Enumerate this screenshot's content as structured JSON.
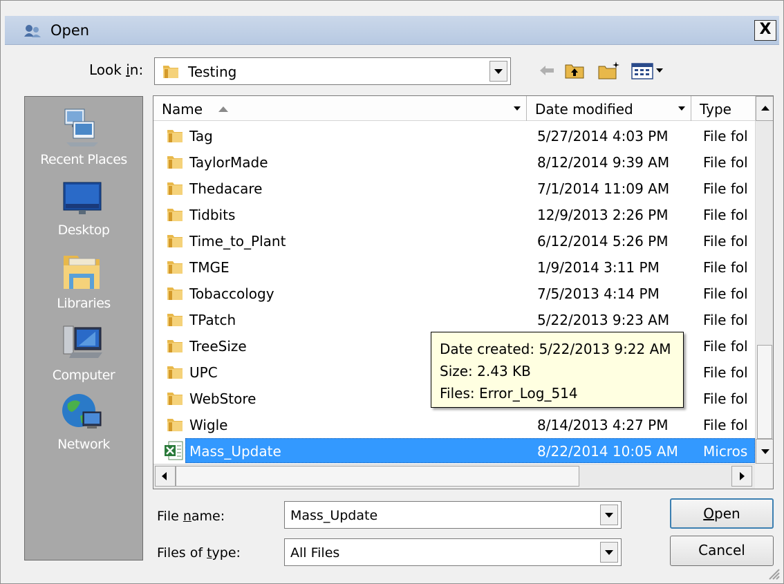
{
  "window": {
    "title": "Open",
    "close_glyph": "X"
  },
  "look_in": {
    "label": "Look in:",
    "value": "Testing",
    "icon": "folder-icon"
  },
  "toolbar": {
    "icons": [
      "back-arrow-icon",
      "up-one-level-icon",
      "new-folder-icon",
      "view-menu-icon"
    ]
  },
  "places": [
    {
      "label": "Recent Places",
      "icon": "recent-places-icon"
    },
    {
      "label": "Desktop",
      "icon": "desktop-icon"
    },
    {
      "label": "Libraries",
      "icon": "libraries-icon"
    },
    {
      "label": "Computer",
      "icon": "computer-icon"
    },
    {
      "label": "Network",
      "icon": "network-icon"
    }
  ],
  "columns": {
    "name": "Name",
    "date": "Date modified",
    "type": "Type"
  },
  "files": [
    {
      "name": "Tag",
      "date": "5/27/2014 4:03 PM",
      "type": "File fol",
      "kind": "folder"
    },
    {
      "name": "TaylorMade",
      "date": "8/12/2014 9:39 AM",
      "type": "File fol",
      "kind": "folder"
    },
    {
      "name": "Thedacare",
      "date": "7/1/2014 11:09 AM",
      "type": "File fol",
      "kind": "folder"
    },
    {
      "name": "Tidbits",
      "date": "12/9/2013 2:26 PM",
      "type": "File fol",
      "kind": "folder"
    },
    {
      "name": "Time_to_Plant",
      "date": "6/12/2014 5:26 PM",
      "type": "File fol",
      "kind": "folder"
    },
    {
      "name": "TMGE",
      "date": "1/9/2014 3:11 PM",
      "type": "File fol",
      "kind": "folder"
    },
    {
      "name": "Tobaccology",
      "date": "7/5/2013 4:14 PM",
      "type": "File fol",
      "kind": "folder"
    },
    {
      "name": "TPatch",
      "date": "5/22/2013 9:23 AM",
      "type": "File fol",
      "kind": "folder"
    },
    {
      "name": "TreeSize",
      "date": "",
      "type": "File fol",
      "kind": "folder"
    },
    {
      "name": "UPC",
      "date": "",
      "type": "File fol",
      "kind": "folder"
    },
    {
      "name": "WebStore",
      "date": "",
      "type": "File fol",
      "kind": "folder"
    },
    {
      "name": "Wigle",
      "date": "8/14/2013 4:27 PM",
      "type": "File fol",
      "kind": "folder"
    },
    {
      "name": "Mass_Update",
      "date": "8/22/2014 10:05 AM",
      "type": "Micros",
      "kind": "excel",
      "selected": true
    }
  ],
  "tooltip": {
    "line1": "Date created: 5/22/2013 9:22 AM",
    "line2": "Size: 2.43 KB",
    "line3": "Files: Error_Log_514"
  },
  "file_name": {
    "label_pre": "File ",
    "label_key": "n",
    "label_post": "ame:",
    "value": "Mass_Update"
  },
  "file_type": {
    "label_pre": "Files of ",
    "label_key": "t",
    "label_post": "ype:",
    "value": "All Files"
  },
  "buttons": {
    "open_key": "O",
    "open_rest": "pen",
    "cancel": "Cancel"
  },
  "colors": {
    "selection": "#3399ff",
    "tooltip_bg": "#ffffe1",
    "places_bg": "#a8a8a8",
    "title_bar": "#c1d1e7"
  }
}
